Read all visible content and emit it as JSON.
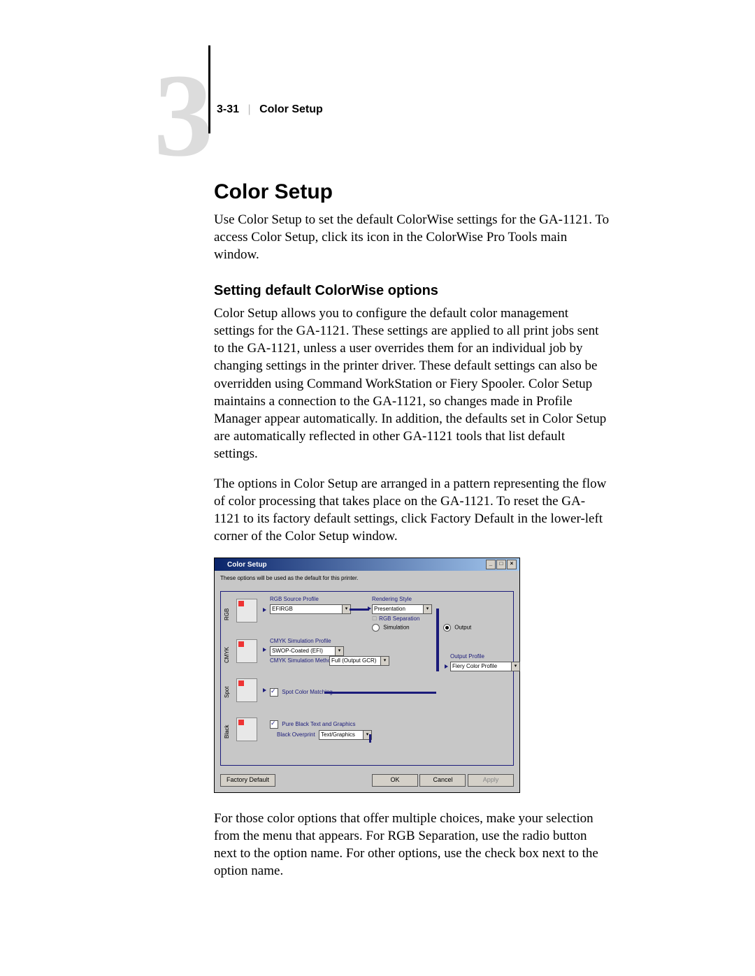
{
  "runhead": {
    "pagenum": "3-31",
    "title": "Color Setup"
  },
  "chapter_number": "3",
  "h1": "Color Setup",
  "intro": "Use Color Setup to set the default ColorWise settings for the GA-1121. To access Color Setup, click its icon in the ColorWise Pro Tools main window.",
  "h2": "Setting default ColorWise options",
  "para1": "Color Setup allows you to configure the default color management settings for the GA-1121. These settings are applied to all print jobs sent to the GA-1121, unless a user overrides them for an individual job by changing settings in the printer driver. These default settings can also be overridden using Command WorkStation or Fiery Spooler. Color Setup maintains a connection to the GA-1121, so changes made in Profile Manager appear automatically. In addition, the defaults set in Color Setup are automatically reflected in other GA-1121 tools that list default settings.",
  "para2": "The options in Color Setup are arranged in a pattern representing the flow of color processing that takes place on the GA-1121. To reset the GA-1121 to its factory default settings, click Factory Default in the lower-left corner of the Color Setup window.",
  "para3": "For those color options that offer multiple choices, make your selection from the menu that appears. For RGB Separation, use the radio button next to the option name. For other options, use the check box next to the option name.",
  "dialog": {
    "title": "Color Setup",
    "note": "These options will be used as the default for this printer.",
    "sections": {
      "rgb": {
        "label": "RGB",
        "source_lbl": "RGB Source Profile",
        "source_val": "EFIRGB",
        "rendering_lbl": "Rendering Style",
        "rendering_val": "Presentation",
        "separation_lbl": "RGB Separation",
        "sep_opt_sim": "Simulation",
        "sep_opt_out": "Output"
      },
      "cmyk": {
        "label": "CMYK",
        "sim_profile_lbl": "CMYK Simulation Profile",
        "sim_profile_val": "SWOP-Coated (EFI)",
        "sim_method_lbl": "CMYK Simulation Method",
        "sim_method_val": "Full (Output GCR)",
        "output_lbl": "Output Profile",
        "output_val": "Fiery Color Profile"
      },
      "spot": {
        "label": "Spot",
        "match_lbl": "Spot Color Matching"
      },
      "black": {
        "label": "Black",
        "pure_lbl": "Pure Black Text and Graphics",
        "overprint_lbl": "Black Overprint",
        "overprint_val": "Text/Graphics"
      }
    },
    "buttons": {
      "factory": "Factory Default",
      "ok": "OK",
      "cancel": "Cancel",
      "apply": "Apply"
    }
  }
}
